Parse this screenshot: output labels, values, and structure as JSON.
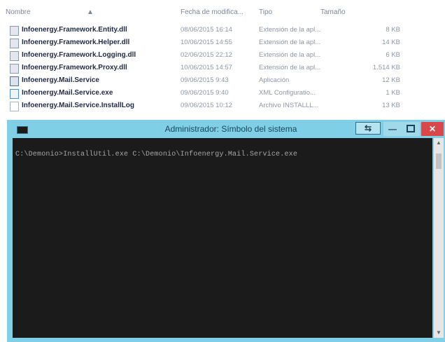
{
  "explorer": {
    "columns": {
      "name": "Nombre",
      "date": "Fecha de modifica...",
      "type": "Tipo",
      "size": "Tamaño"
    },
    "files": [
      {
        "name": "Infoenergy.Framework.Entity.dll",
        "date": "08/06/2015 16:14",
        "type": "Extensión de la apl...",
        "size": "8 KB",
        "icon": "dll-icon"
      },
      {
        "name": "Infoenergy.Framework.Helper.dll",
        "date": "10/06/2015 14:55",
        "type": "Extensión de la apl...",
        "size": "14 KB",
        "icon": "dll-icon"
      },
      {
        "name": "Infoenergy.Framework.Logging.dll",
        "date": "02/06/2015 22:12",
        "type": "Extensión de la apl...",
        "size": "6 KB",
        "icon": "dll-icon"
      },
      {
        "name": "Infoenergy.Framework.Proxy.dll",
        "date": "10/06/2015 14:57",
        "type": "Extensión de la apl...",
        "size": "1.514 KB",
        "icon": "dll-icon"
      },
      {
        "name": "Infoenergy.Mail.Service",
        "date": "09/06/2015 9:43",
        "type": "Aplicación",
        "size": "12 KB",
        "icon": "exe-icon"
      },
      {
        "name": "Infoenergy.Mail.Service.exe",
        "date": "09/06/2015 9:40",
        "type": "XML Configuratio...",
        "size": "1 KB",
        "icon": "config-icon"
      },
      {
        "name": "Infoenergy.Mail.Service.InstallLog",
        "date": "09/06/2015 10:12",
        "type": "Archivo INSTALLL...",
        "size": "13 KB",
        "icon": "log-icon"
      }
    ]
  },
  "cmd": {
    "title": "Administrador: Símbolo del sistema",
    "command_line": "C:\\Demonio>InstallUtil.exe C:\\Demonio\\Infoenergy.Mail.Service.exe",
    "buttons": {
      "restore": "⇆",
      "minimize": "—",
      "close": "✕"
    }
  },
  "colors": {
    "titlebar": "#7fd0e6",
    "console_bg": "#1b1b1b",
    "close": "#d8474a"
  }
}
